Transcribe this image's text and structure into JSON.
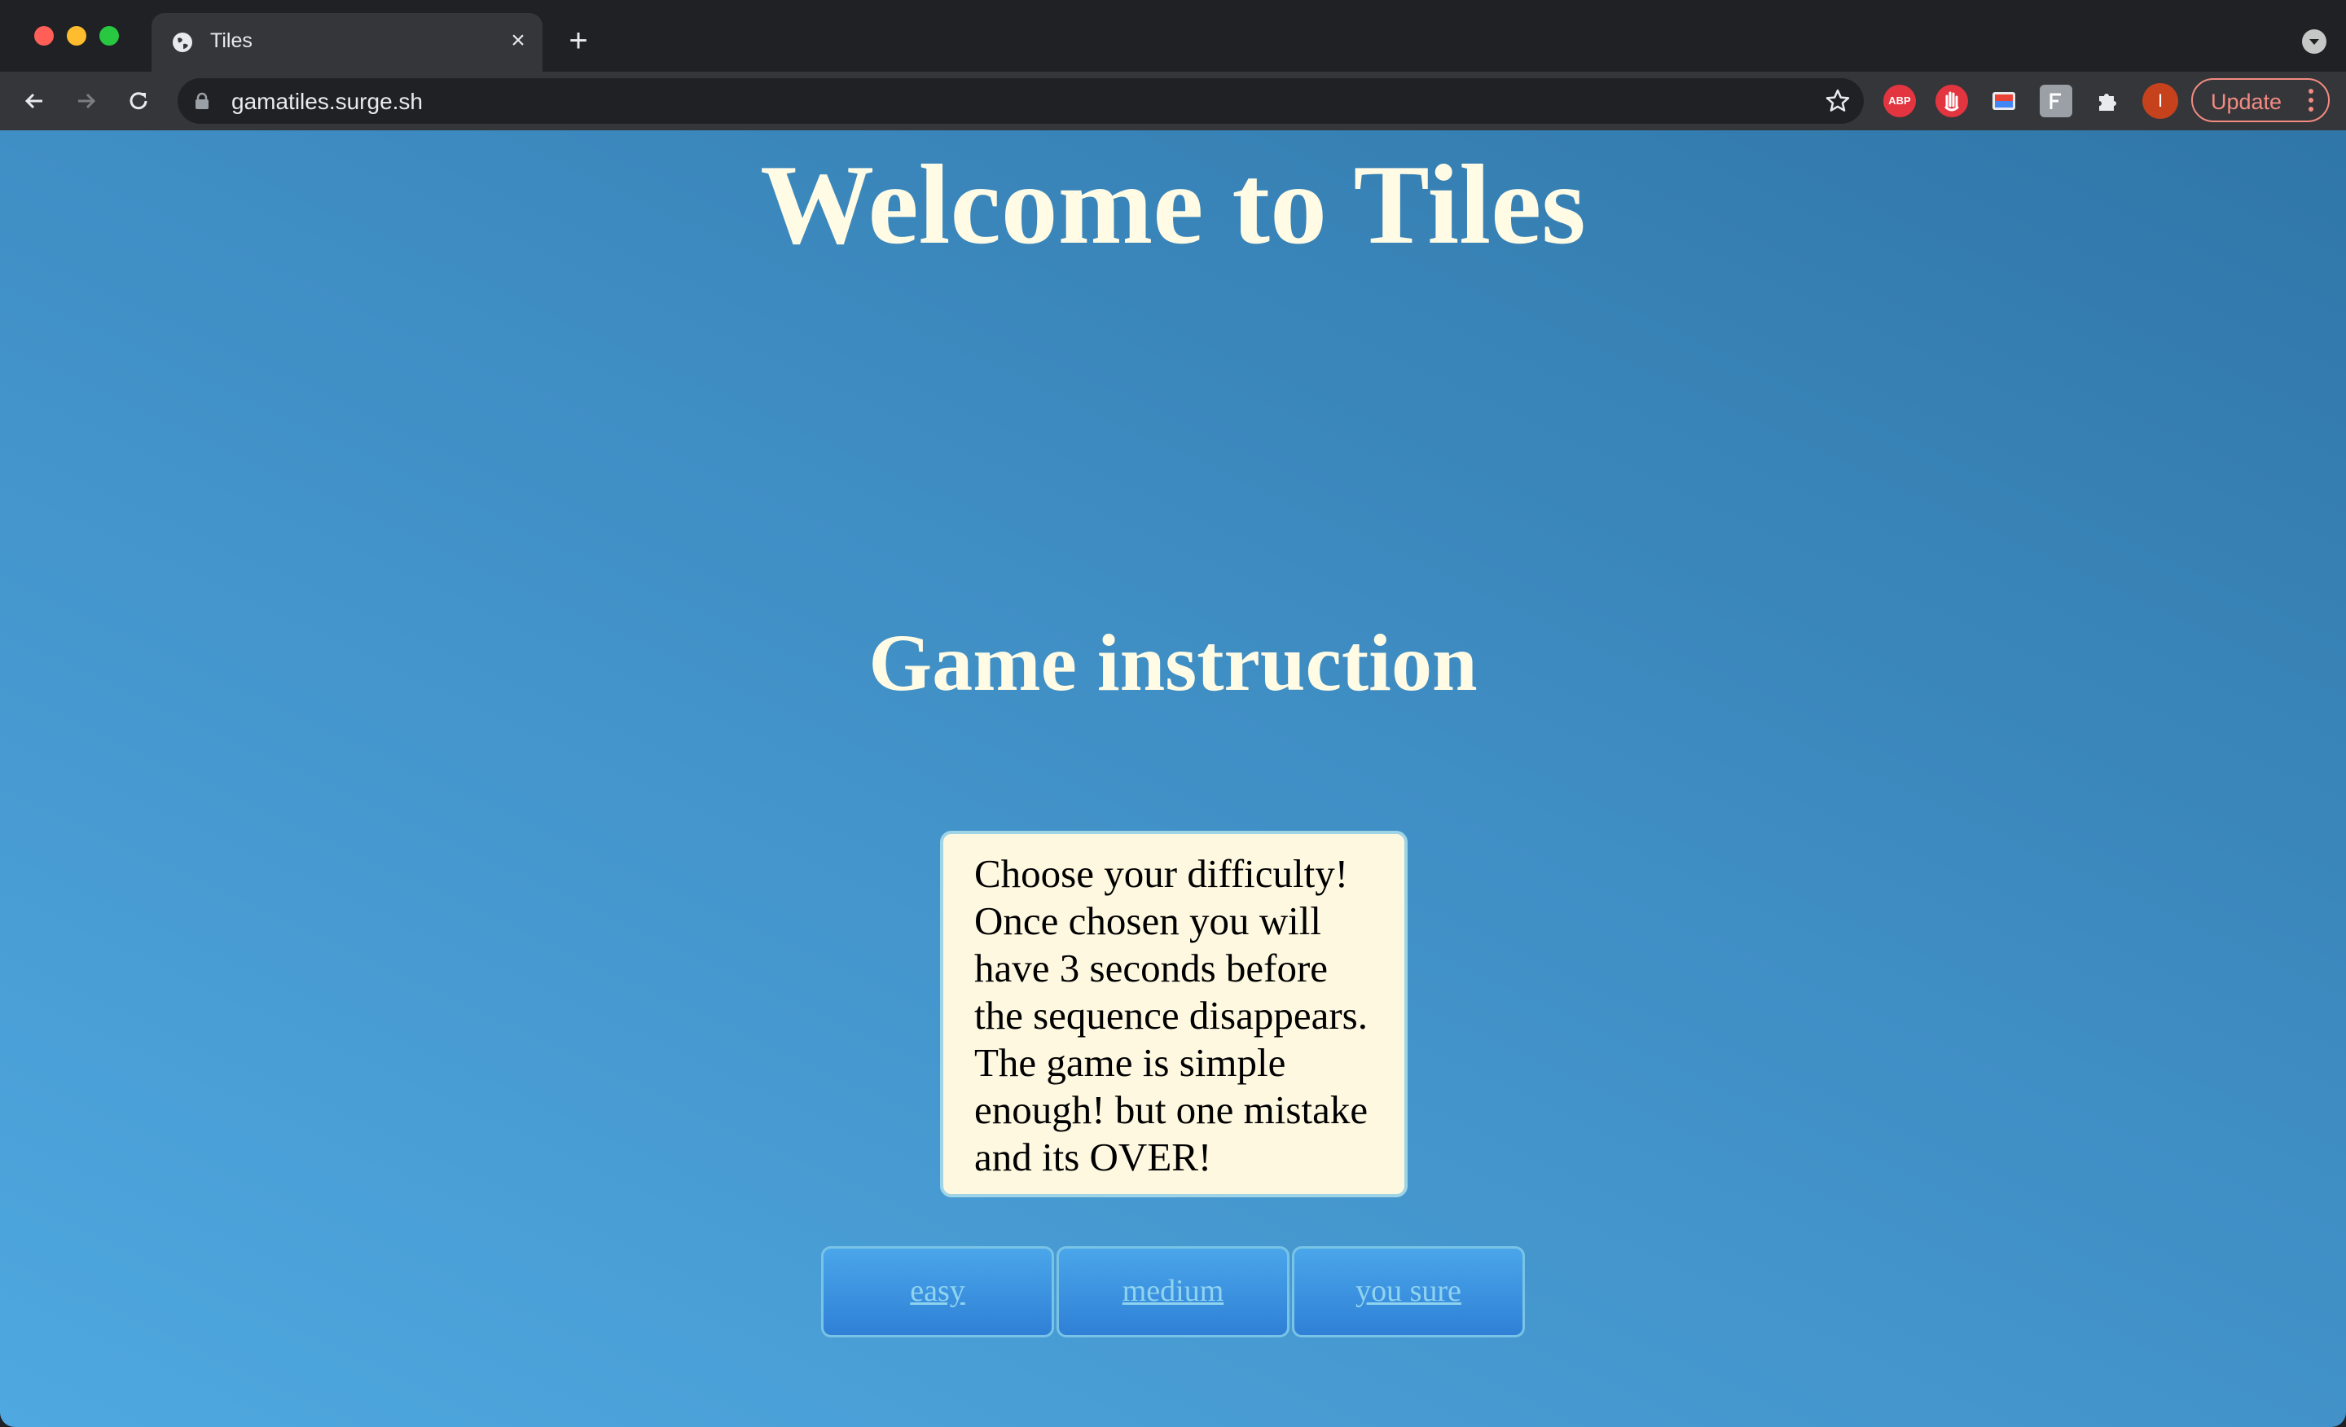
{
  "browser": {
    "tab": {
      "title": "Tiles",
      "close_glyph": "×",
      "favicon": "globe-icon"
    },
    "new_tab_glyph": "+",
    "url": "gamatiles.surge.sh",
    "extensions": {
      "abp_label": "ABP"
    },
    "avatar_initial": "I",
    "update_label": "Update"
  },
  "page": {
    "title": "Welcome to Tiles",
    "subtitle": "Game instruction",
    "instructions": "Choose your difficulty! Once chosen you will have 3 seconds before the sequence disappears. The game is simple enough! but one mistake and its OVER!",
    "difficulty_buttons": {
      "easy": "easy",
      "medium": "medium",
      "hard": "you sure"
    }
  },
  "colors": {
    "title_text": "#fffbe5",
    "page_gradient_start": "#3076a8",
    "page_gradient_end": "#4fa8e0",
    "instruction_box": "#fef8e0",
    "button_fill": "#2f80d6",
    "button_text": "#8fd3ef"
  }
}
